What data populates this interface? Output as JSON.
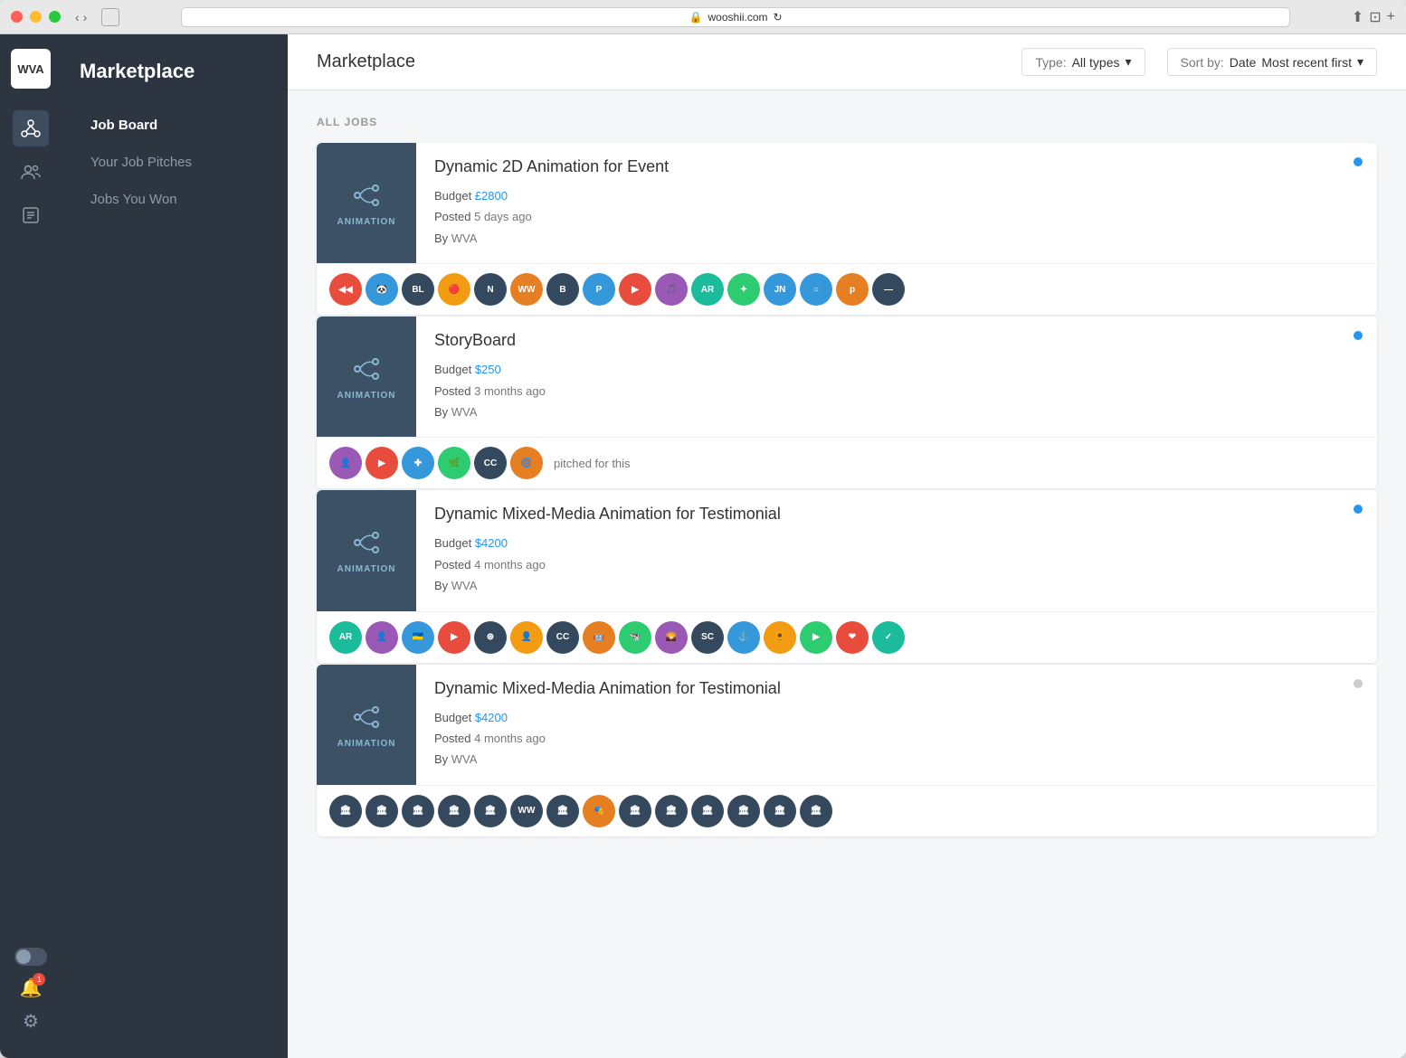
{
  "window": {
    "url": "wooshii.com",
    "traffic_lights": [
      "red",
      "yellow",
      "green"
    ]
  },
  "logo": "WVA",
  "sidebar": {
    "title": "Marketplace",
    "nav_items": [
      {
        "id": "job-board",
        "label": "Job Board",
        "active": true
      },
      {
        "id": "your-pitches",
        "label": "Your Job Pitches",
        "active": false
      },
      {
        "id": "jobs-won",
        "label": "Jobs You Won",
        "active": false
      }
    ],
    "icons": [
      {
        "id": "network-icon",
        "symbol": "⊞"
      },
      {
        "id": "users-icon",
        "symbol": "👥"
      },
      {
        "id": "list-icon",
        "symbol": "📋"
      }
    ]
  },
  "topbar": {
    "title": "Marketplace",
    "type_filter_label": "Type:",
    "type_filter_value": "All types",
    "sort_label": "Sort by:",
    "sort_key": "Date",
    "sort_value": "Most recent first"
  },
  "content": {
    "section_label": "ALL JOBS",
    "jobs": [
      {
        "id": "job-1",
        "title": "Dynamic 2D Animation for Event",
        "type": "ANIMATION",
        "budget_label": "Budget",
        "budget_value": "£2800",
        "posted_label": "Posted",
        "posted_value": "5 days ago",
        "by_label": "By",
        "by_value": "WVA",
        "dot_active": true,
        "avatars": [
          {
            "id": "a1",
            "text": "◀◀",
            "color": "color-1"
          },
          {
            "id": "a2",
            "text": "🐼",
            "color": "color-2"
          },
          {
            "id": "a3",
            "text": "BL",
            "color": "color-8"
          },
          {
            "id": "a4",
            "text": "🔴",
            "color": "color-4"
          },
          {
            "id": "a5",
            "text": "N",
            "color": "color-8"
          },
          {
            "id": "a6",
            "text": "WW",
            "color": "color-7"
          },
          {
            "id": "a7",
            "text": "B",
            "color": "color-8"
          },
          {
            "id": "a8",
            "text": "P",
            "color": "color-2"
          },
          {
            "id": "a9",
            "text": "▶",
            "color": "color-1"
          },
          {
            "id": "a10",
            "text": "🎵",
            "color": "color-5"
          },
          {
            "id": "a11",
            "text": "AR",
            "color": "color-6"
          },
          {
            "id": "a12",
            "text": "✦",
            "color": "color-3"
          },
          {
            "id": "a13",
            "text": "JN",
            "color": "color-2"
          },
          {
            "id": "a14",
            "text": "○",
            "color": "color-2"
          },
          {
            "id": "a15",
            "text": "p",
            "color": "color-7"
          },
          {
            "id": "a16",
            "text": "—",
            "color": "color-8"
          }
        ],
        "pitched_text": null
      },
      {
        "id": "job-2",
        "title": "StoryBoard",
        "type": "ANIMATION",
        "budget_label": "Budget",
        "budget_value": "$250",
        "posted_label": "Posted",
        "posted_value": "3 months ago",
        "by_label": "By",
        "by_value": "WVA",
        "dot_active": true,
        "avatars": [
          {
            "id": "b1",
            "text": "👤",
            "color": "color-5"
          },
          {
            "id": "b2",
            "text": "▶",
            "color": "color-1"
          },
          {
            "id": "b3",
            "text": "✚",
            "color": "color-2"
          },
          {
            "id": "b4",
            "text": "🌿",
            "color": "color-3"
          },
          {
            "id": "b5",
            "text": "CC",
            "color": "color-8"
          },
          {
            "id": "b6",
            "text": "🌀",
            "color": "color-7"
          }
        ],
        "pitched_text": "pitched for this"
      },
      {
        "id": "job-3",
        "title": "Dynamic Mixed-Media Animation for Testimonial",
        "type": "ANIMATION",
        "budget_label": "Budget",
        "budget_value": "$4200",
        "posted_label": "Posted",
        "posted_value": "4 months ago",
        "by_label": "By",
        "by_value": "WVA",
        "dot_active": true,
        "avatars": [
          {
            "id": "c1",
            "text": "AR",
            "color": "color-6"
          },
          {
            "id": "c2",
            "text": "👤",
            "color": "color-5"
          },
          {
            "id": "c3",
            "text": "🇺🇦",
            "color": "color-2"
          },
          {
            "id": "c4",
            "text": "▶",
            "color": "color-1"
          },
          {
            "id": "c5",
            "text": "⊛",
            "color": "color-8"
          },
          {
            "id": "c6",
            "text": "👤",
            "color": "color-4"
          },
          {
            "id": "c7",
            "text": "CC",
            "color": "color-8"
          },
          {
            "id": "c8",
            "text": "🤖",
            "color": "color-7"
          },
          {
            "id": "c9",
            "text": "🐄",
            "color": "color-3"
          },
          {
            "id": "c10",
            "text": "🌄",
            "color": "color-5"
          },
          {
            "id": "c11",
            "text": "SC",
            "color": "color-8"
          },
          {
            "id": "c12",
            "text": "⚓",
            "color": "color-2"
          },
          {
            "id": "c13",
            "text": "🌻",
            "color": "color-4"
          },
          {
            "id": "c14",
            "text": "▶",
            "color": "color-3"
          },
          {
            "id": "c15",
            "text": "❤",
            "color": "color-1"
          },
          {
            "id": "c16",
            "text": "✓",
            "color": "color-6"
          }
        ],
        "pitched_text": null
      },
      {
        "id": "job-4",
        "title": "Dynamic Mixed-Media Animation for Testimonial",
        "type": "ANIMATION",
        "budget_label": "Budget",
        "budget_value": "$4200",
        "posted_label": "Posted",
        "posted_value": "4 months ago",
        "by_label": "By",
        "by_value": "WVA",
        "dot_active": false,
        "avatars": [
          {
            "id": "d1",
            "text": "🏛",
            "color": "color-8"
          },
          {
            "id": "d2",
            "text": "🏛",
            "color": "color-8"
          },
          {
            "id": "d3",
            "text": "🏛",
            "color": "color-8"
          },
          {
            "id": "d4",
            "text": "🏛",
            "color": "color-8"
          },
          {
            "id": "d5",
            "text": "🏛",
            "color": "color-8"
          },
          {
            "id": "d6",
            "text": "WW",
            "color": "color-8"
          },
          {
            "id": "d7",
            "text": "🏛",
            "color": "color-8"
          },
          {
            "id": "d8",
            "text": "🎭",
            "color": "color-7"
          },
          {
            "id": "d9",
            "text": "🏛",
            "color": "color-8"
          },
          {
            "id": "d10",
            "text": "🏛",
            "color": "color-8"
          },
          {
            "id": "d11",
            "text": "🏛",
            "color": "color-8"
          },
          {
            "id": "d12",
            "text": "🏛",
            "color": "color-8"
          },
          {
            "id": "d13",
            "text": "🏛",
            "color": "color-8"
          },
          {
            "id": "d14",
            "text": "🏛",
            "color": "color-8"
          }
        ],
        "pitched_text": null
      }
    ]
  },
  "bottom_icons": {
    "bell_count": "1",
    "toggle_label": "toggle"
  }
}
